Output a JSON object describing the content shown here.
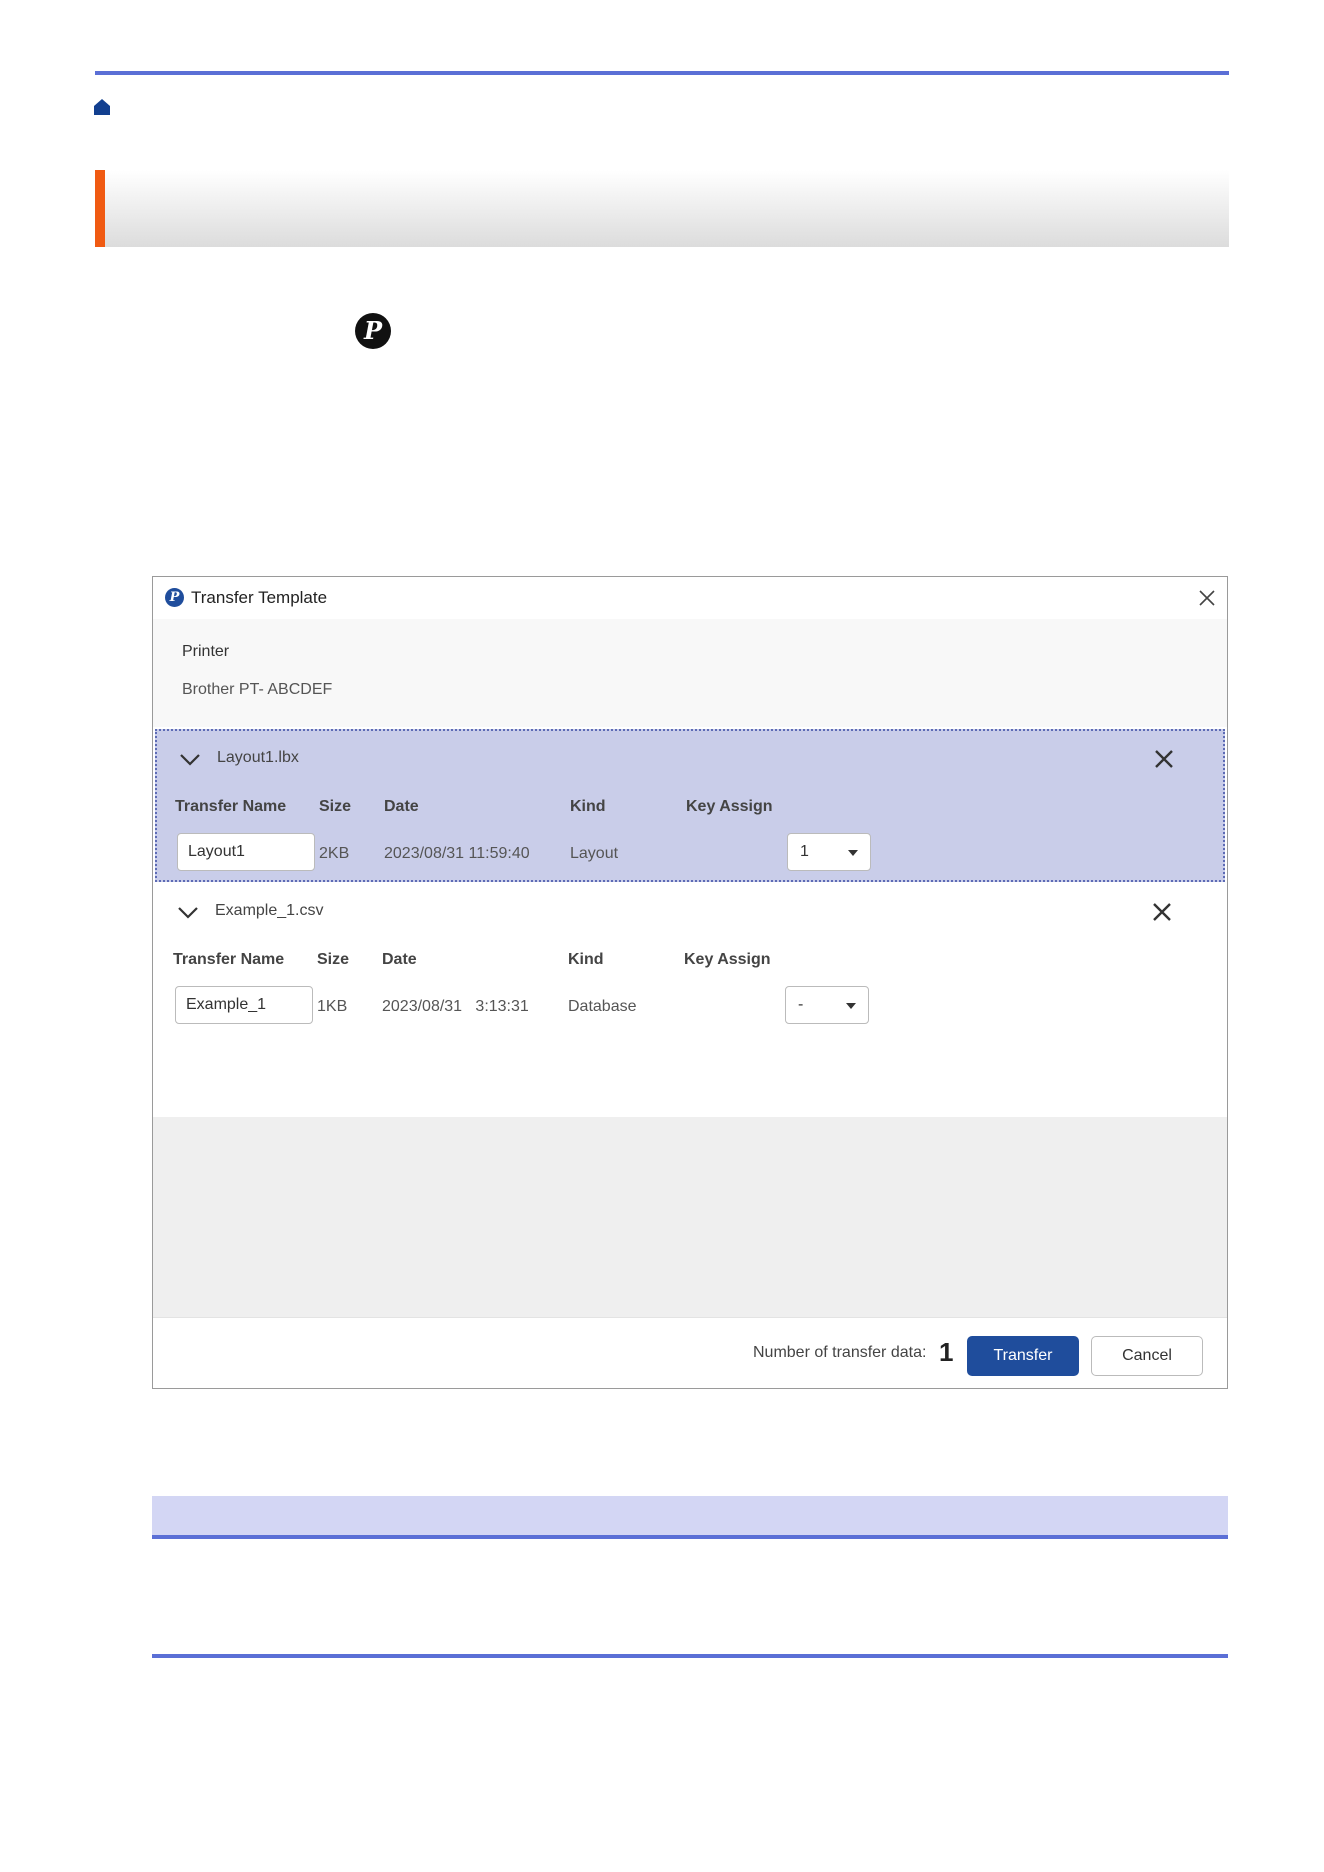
{
  "page": {
    "logo_letter": "P"
  },
  "dialog": {
    "title": "Transfer Template",
    "icon_letter": "P",
    "printer_label": "Printer",
    "printer_name": "Brother PT- ABCDEF",
    "columns": {
      "transfer_name": "Transfer Name",
      "size": "Size",
      "date": "Date",
      "kind": "Kind",
      "key_assign": "Key Assign"
    },
    "files": [
      {
        "file_name": "Layout1.lbx",
        "transfer_name": "Layout1",
        "size": "2KB",
        "date": "2023/08/31 11:59:40",
        "kind": "Layout",
        "key_assign": "1",
        "selected": true
      },
      {
        "file_name": "Example_1.csv",
        "transfer_name": "Example_1",
        "size": "1KB",
        "date": "2023/08/31   3:13:31",
        "kind": "Database",
        "key_assign": "-",
        "selected": false
      }
    ],
    "count_label": "Number of transfer data:",
    "count_value": "1",
    "transfer_button": "Transfer",
    "cancel_button": "Cancel"
  },
  "colors": {
    "rule_blue": "#5b6fd6",
    "accent_orange": "#f05a12",
    "selected_panel": "#c9cde9",
    "primary_button": "#1f4d9c",
    "note_header": "#d3d6f4"
  },
  "icons": [
    "home-icon",
    "p-logo-icon",
    "close-icon",
    "chevron-down-icon",
    "dropdown-arrow-icon"
  ]
}
